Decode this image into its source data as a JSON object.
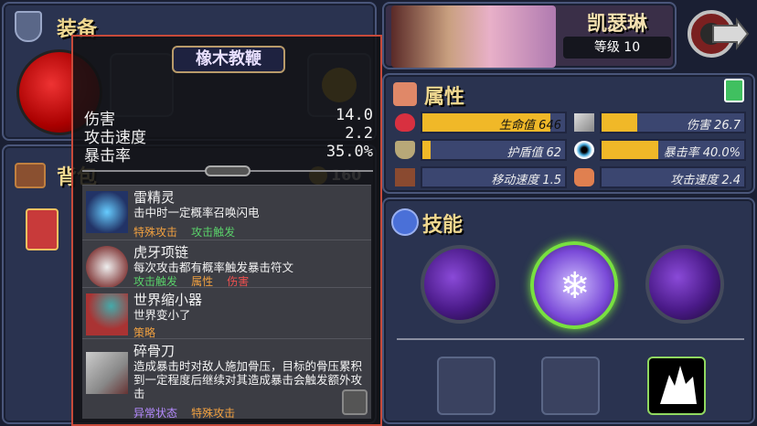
{
  "equipment": {
    "title": "装备"
  },
  "bag": {
    "title": "背包",
    "coins": "160"
  },
  "tooltip": {
    "item_name": "橡木教鞭",
    "stats": [
      {
        "label": "伤害",
        "value": "14.0"
      },
      {
        "label": "攻击速度",
        "value": "2.2"
      },
      {
        "label": "暴击率",
        "value": "35.0%"
      }
    ],
    "perks": [
      {
        "name": "雷精灵",
        "desc": "击中时一定概率召唤闪电",
        "tags": [
          {
            "text": "特殊攻击",
            "color": "orange"
          },
          {
            "text": "攻击触发",
            "color": "green"
          }
        ]
      },
      {
        "name": "虎牙项链",
        "desc": "每次攻击都有概率触发暴击符文",
        "tags": [
          {
            "text": "攻击触发",
            "color": "green"
          },
          {
            "text": "属性",
            "color": "orange"
          },
          {
            "text": "伤害",
            "color": "red"
          }
        ]
      },
      {
        "name": "世界缩小器",
        "desc": "世界变小了",
        "tags": [
          {
            "text": "策略",
            "color": "orange"
          }
        ]
      },
      {
        "name": "碎骨刀",
        "desc": "造成暴击时对敌人施加骨压，目标的骨压累积到一定程度后继续对其造成暴击会触发额外攻击",
        "tags": [
          {
            "text": "异常状态",
            "color": "purple"
          },
          {
            "text": "特殊攻击",
            "color": "orange"
          }
        ]
      }
    ]
  },
  "character": {
    "name": "凯瑟琳",
    "level": "等级 10"
  },
  "attributes": {
    "title": "属性",
    "items": [
      {
        "label": "生命值 646",
        "fill": 0.9,
        "icon": "heart-icon"
      },
      {
        "label": "伤害 26.7",
        "fill": 0.25,
        "icon": "sword-icon"
      },
      {
        "label": "护盾值 62",
        "fill": 0.06,
        "icon": "shield-icon"
      },
      {
        "label": "暴击率 40.0%",
        "fill": 0.4,
        "icon": "eye-icon"
      },
      {
        "label": "移动速度 1.5",
        "fill": 0.0,
        "icon": "boot-icon"
      },
      {
        "label": "攻击速度 2.4",
        "fill": 0.0,
        "icon": "fist-icon"
      }
    ]
  },
  "skills": {
    "title": "技能"
  }
}
